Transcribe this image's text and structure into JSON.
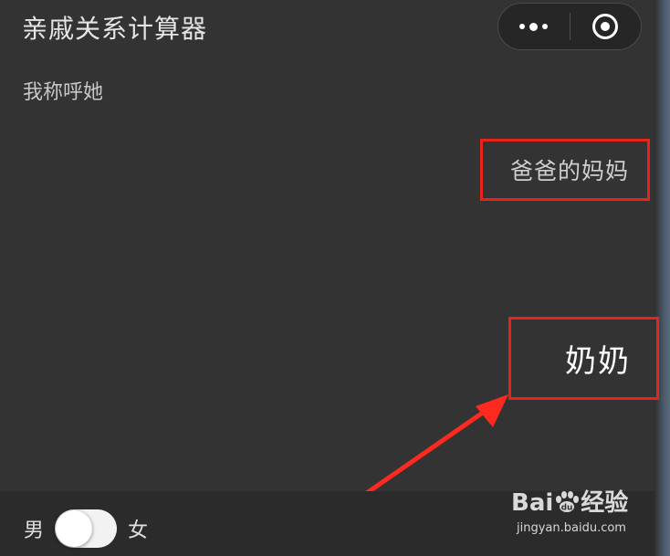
{
  "navbar": {
    "title": "亲戚关系计算器",
    "menu_icon": "more-dots-icon",
    "close_icon": "target-circle-icon"
  },
  "prompt": {
    "label": "我称呼她"
  },
  "relation": {
    "value": "爸爸的妈妈"
  },
  "result": {
    "value": "奶奶"
  },
  "gender": {
    "male_label": "男",
    "female_label": "女",
    "toggle_on": false
  },
  "watermark": {
    "logo": "Bai经验",
    "logo_text_left": "Bai",
    "logo_text_du": "du",
    "logo_text_right": "经验",
    "url": "jingyan.baidu.com"
  },
  "colors": {
    "background": "#333333",
    "highlight": "#e8231b",
    "text": "#cfcfcf"
  }
}
